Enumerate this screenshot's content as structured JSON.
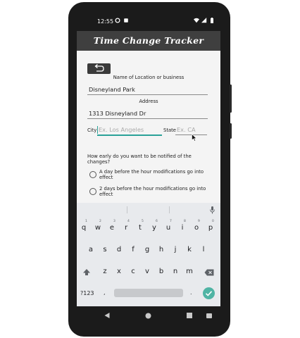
{
  "status_bar": {
    "time": "12:55"
  },
  "app_bar": {
    "title": "Time Change Tracker"
  },
  "form": {
    "location_label": "Name of Location or business",
    "location_value": "Disneyland Park",
    "address_label": "Address",
    "address_value": "1313 Disneyland Dr",
    "city_label": "City",
    "city_placeholder": "Ex. Los Angeles",
    "state_label": "State",
    "state_placeholder": "Ex. CA",
    "question": "How early do you want to be notified of the changes?",
    "options": [
      "A day before the hour modifications go into effect",
      "2 days before the hour modifications go into effect"
    ]
  },
  "keyboard": {
    "row1": [
      "q",
      "w",
      "e",
      "r",
      "t",
      "y",
      "u",
      "i",
      "o",
      "p"
    ],
    "row1_numbers": [
      "1",
      "2",
      "3",
      "4",
      "5",
      "6",
      "7",
      "8",
      "9",
      "0"
    ],
    "row2": [
      "a",
      "s",
      "d",
      "f",
      "g",
      "h",
      "j",
      "k",
      "l"
    ],
    "row3": [
      "z",
      "x",
      "c",
      "v",
      "b",
      "n",
      "m"
    ],
    "symbols_key": "?123",
    "comma_key": ",",
    "period_key": "."
  },
  "colors": {
    "accent": "#4fb4a4",
    "app_bar": "#3f3f3f"
  }
}
